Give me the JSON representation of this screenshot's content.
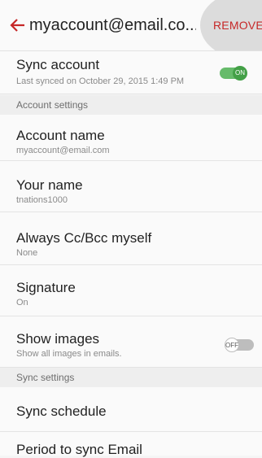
{
  "header": {
    "title": "myaccount@email.co...",
    "remove_label": "REMOVE"
  },
  "sync_account": {
    "title": "Sync account",
    "subtitle": "Last synced on October 29, 2015  1:49 PM",
    "toggle_label": "ON",
    "state": true
  },
  "section_account": "Account settings",
  "account_name": {
    "title": "Account name",
    "value": "myaccount@email.com"
  },
  "your_name": {
    "title": "Your name",
    "value": "tnations1000"
  },
  "always_cc": {
    "title": "Always Cc/Bcc myself",
    "value": "None"
  },
  "signature": {
    "title": "Signature",
    "value": "On"
  },
  "show_images": {
    "title": "Show images",
    "subtitle": "Show all images in emails.",
    "toggle_label": "OFF",
    "state": false
  },
  "section_sync": "Sync settings",
  "sync_schedule": {
    "title": "Sync schedule"
  },
  "period_sync": {
    "title": "Period to sync Email"
  },
  "colors": {
    "accent_green": "#4caf50",
    "remove_red": "#c62828"
  }
}
